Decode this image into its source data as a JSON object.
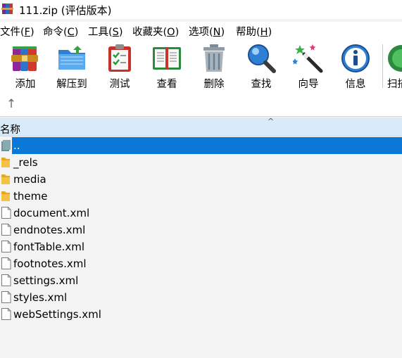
{
  "window": {
    "title": "111.zip (评估版本)"
  },
  "menu": [
    {
      "label": "文件(",
      "key": "F",
      "suffix": ")"
    },
    {
      "label": "命令(",
      "key": "C",
      "suffix": ")"
    },
    {
      "label": "工具(",
      "key": "S",
      "suffix": ")"
    },
    {
      "label": "收藏夹(",
      "key": "O",
      "suffix": ")"
    },
    {
      "label": "选项(",
      "key": "N",
      "suffix": ")"
    },
    {
      "label": "帮助(",
      "key": "H",
      "suffix": ")"
    }
  ],
  "toolbar": {
    "add": "添加",
    "extract": "解压到",
    "test": "测试",
    "view": "查看",
    "delete": "删除",
    "find": "查找",
    "wizard": "向导",
    "info": "信息",
    "scan": "扫描"
  },
  "list": {
    "column_name": "名称",
    "rows": [
      {
        "name": "..",
        "type": "parent",
        "selected": true
      },
      {
        "name": "_rels",
        "type": "folder"
      },
      {
        "name": "media",
        "type": "folder"
      },
      {
        "name": "theme",
        "type": "folder"
      },
      {
        "name": "document.xml",
        "type": "file"
      },
      {
        "name": "endnotes.xml",
        "type": "file"
      },
      {
        "name": "fontTable.xml",
        "type": "file"
      },
      {
        "name": "footnotes.xml",
        "type": "file"
      },
      {
        "name": "settings.xml",
        "type": "file"
      },
      {
        "name": "styles.xml",
        "type": "file"
      },
      {
        "name": "webSettings.xml",
        "type": "file"
      }
    ]
  },
  "colors": {
    "selection": "#0a78d6",
    "header": "#d9ebf9",
    "folder": "#f5c242"
  }
}
